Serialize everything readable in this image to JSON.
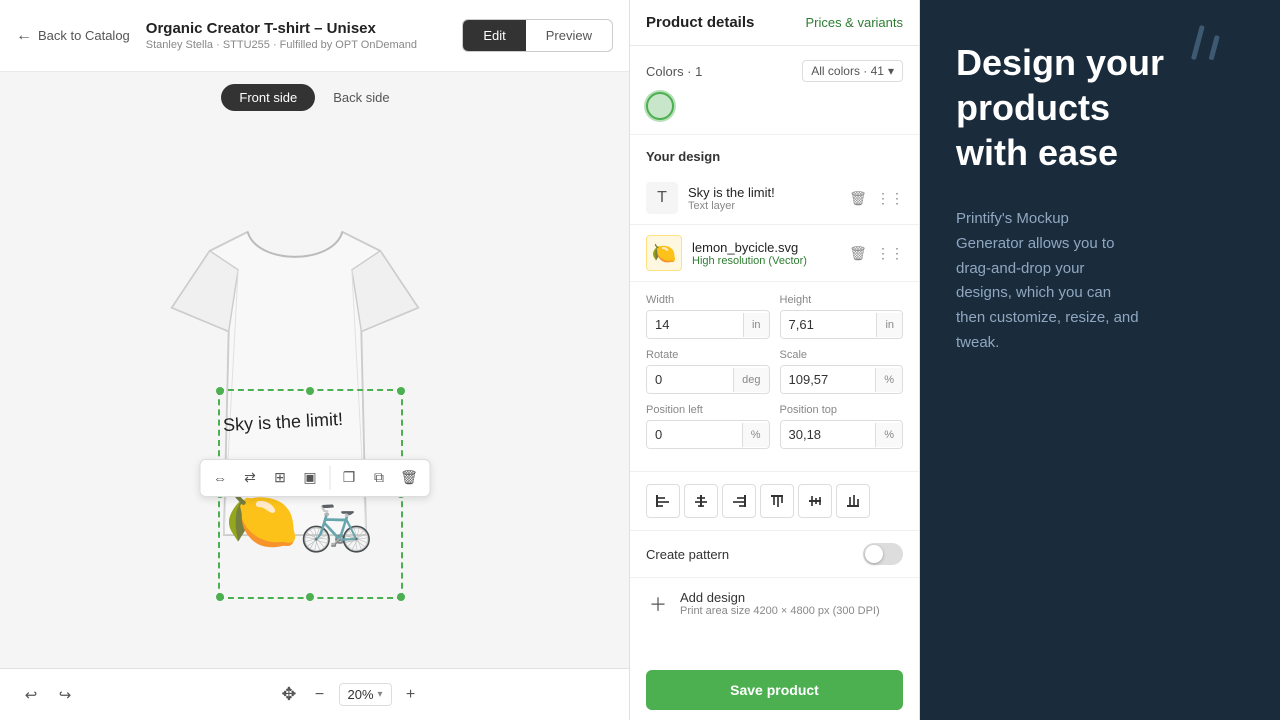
{
  "header": {
    "back_label": "Back to Catalog",
    "product_title": "Organic Creator T-shirt – Unisex",
    "product_subtitle": "Stanley Stella · STTU255 · Fulfilled by OPT OnDemand",
    "tab_edit": "Edit",
    "tab_preview": "Preview"
  },
  "canvas": {
    "side_front": "Front side",
    "side_back": "Back side",
    "shirt_text": "Sky is the limit!"
  },
  "bottom_bar": {
    "zoom_level": "20%",
    "zoom_minus": "−",
    "zoom_plus": "+"
  },
  "product_details": {
    "title": "Product details",
    "prices_link": "Prices & variants",
    "colors_label": "Colors · 1",
    "all_colors": "All colors · 41",
    "your_design_label": "Your design",
    "design_layers": [
      {
        "name": "Sky is the limit!",
        "type": "Text layer"
      }
    ],
    "svg_layer": {
      "name": "lemon_bycicle.svg",
      "status": "High resolution (Vector)"
    },
    "fields": {
      "width_label": "Width",
      "width_value": "14",
      "width_unit": "in",
      "height_label": "Height",
      "height_value": "7,61",
      "height_unit": "in",
      "rotate_label": "Rotate",
      "rotate_value": "0",
      "rotate_unit": "deg",
      "scale_label": "Scale",
      "scale_value": "109,57",
      "scale_unit": "%",
      "pos_left_label": "Position left",
      "pos_left_value": "0",
      "pos_left_unit": "%",
      "pos_top_label": "Position top",
      "pos_top_value": "30,18",
      "pos_top_unit": "%"
    },
    "pattern_label": "Create pattern",
    "add_design_title": "Add design",
    "add_design_sub": "Print area size 4200 × 4800 px (300 DPI)",
    "save_btn": "Save product"
  },
  "promo": {
    "heading": "Design your\nproducts\nwith ease",
    "body": "Printify's Mockup\nGenerator allows you to\ndrag-and-drop your\ndesigns, which you can\nthen customize, resize, and\ntweak."
  },
  "toolbar_icons": [
    "resize-icon",
    "flip-h-icon",
    "crop-icon",
    "frame-icon",
    "duplicate-icon",
    "copy-icon",
    "delete-icon"
  ],
  "align_icons": [
    "align-left-icon",
    "align-center-h-icon",
    "align-right-icon",
    "align-top-icon",
    "align-middle-v-icon",
    "align-bottom-icon"
  ]
}
